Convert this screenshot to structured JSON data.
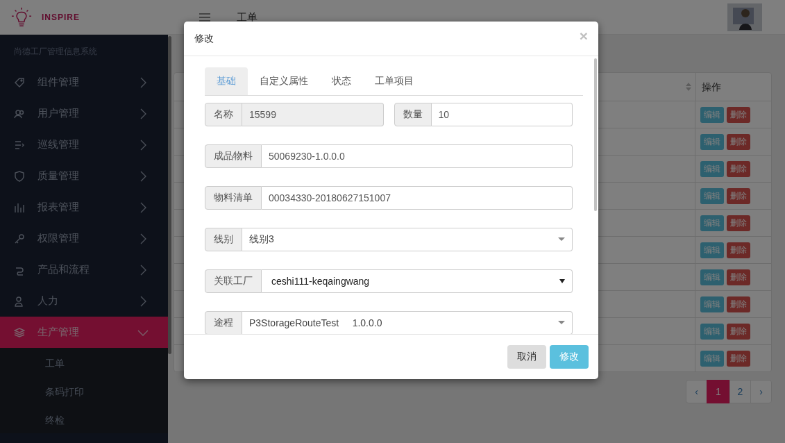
{
  "brand": {
    "name": "INSPIRE"
  },
  "header": {
    "title": "工单"
  },
  "sidebar": {
    "subtitle": "尚德工厂管理信息系统",
    "items": [
      {
        "label": "组件管理",
        "selected": false,
        "expanded": false
      },
      {
        "label": "用户管理",
        "selected": false,
        "expanded": false
      },
      {
        "label": "巡线管理",
        "selected": false,
        "expanded": false
      },
      {
        "label": "质量管理",
        "selected": false,
        "expanded": false
      },
      {
        "label": "报表管理",
        "selected": false,
        "expanded": false
      },
      {
        "label": "权限管理",
        "selected": false,
        "expanded": false
      },
      {
        "label": "产品和流程",
        "selected": false,
        "expanded": false
      },
      {
        "label": "人力",
        "selected": false,
        "expanded": false
      },
      {
        "label": "生产管理",
        "selected": true,
        "expanded": true,
        "children": [
          {
            "label": "工单"
          },
          {
            "label": "条码打印"
          },
          {
            "label": "终检"
          }
        ]
      }
    ]
  },
  "table": {
    "columns": [
      {
        "label": "操作"
      }
    ],
    "rows": [
      {
        "actions": [
          "编辑",
          "删除"
        ]
      },
      {
        "actions": [
          "编辑",
          "删除"
        ]
      },
      {
        "actions": [
          "编辑",
          "删除"
        ]
      },
      {
        "actions": [
          "编辑",
          "删除"
        ]
      },
      {
        "actions": [
          "编辑",
          "删除"
        ]
      },
      {
        "actions": [
          "编辑",
          "删除"
        ]
      },
      {
        "actions": [
          "编辑",
          "删除"
        ]
      },
      {
        "actions": [
          "编辑",
          "删除"
        ]
      },
      {
        "actions": [
          "编辑",
          "删除"
        ]
      },
      {
        "actions": [
          "编辑",
          "删除"
        ]
      }
    ]
  },
  "pagination": {
    "prev": "‹",
    "next": "›",
    "pages": [
      {
        "label": "1",
        "selected": true
      },
      {
        "label": "2",
        "selected": false
      }
    ]
  },
  "dialog": {
    "title": "修改",
    "close": "×",
    "tabs": [
      {
        "label": "基础",
        "selected": true
      },
      {
        "label": "自定义属性",
        "selected": false
      },
      {
        "label": "状态",
        "selected": false
      },
      {
        "label": "工单项目",
        "selected": false
      }
    ],
    "rows": [
      [
        {
          "kind": "text",
          "label": "名称",
          "value": "15599",
          "disabled": true
        },
        {
          "kind": "text",
          "label": "数量",
          "value": "10",
          "disabled": false
        }
      ],
      [
        {
          "kind": "text",
          "label": "成品物料",
          "value": "50069230-1.0.0.0",
          "disabled": false
        }
      ],
      [
        {
          "kind": "text",
          "label": "物料清单",
          "value": "00034330-20180627151007",
          "disabled": false
        }
      ],
      [
        {
          "kind": "select",
          "label": "线别",
          "value": "线别3"
        }
      ],
      [
        {
          "kind": "native-select",
          "label": "关联工厂",
          "value": "ceshi111-keqaingwang"
        }
      ],
      [
        {
          "kind": "select",
          "label": "途程",
          "value": "P3StorageRouteTest     1.0.0.0"
        }
      ]
    ],
    "buttons": [
      {
        "label": "取消",
        "kind": "default"
      },
      {
        "label": "修改",
        "kind": "primary"
      }
    ]
  }
}
